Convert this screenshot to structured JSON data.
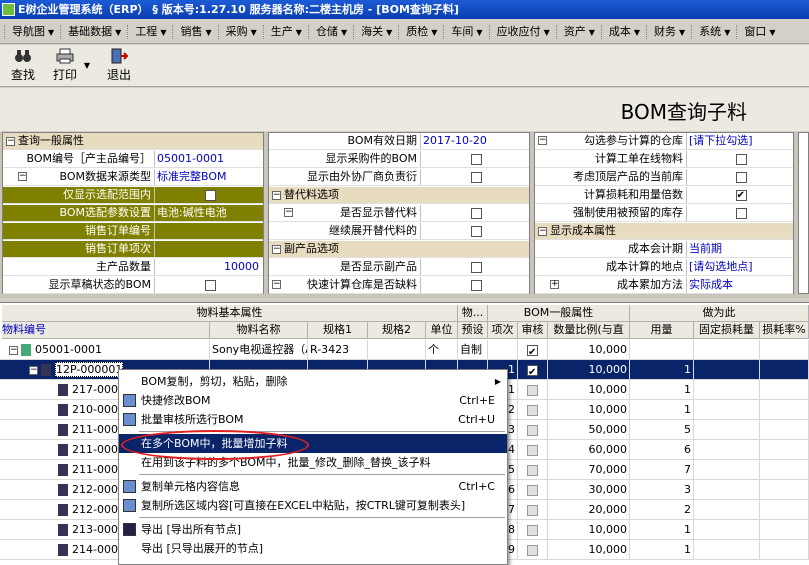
{
  "window": {
    "title": "E树企业管理系统（ERP） § 版本号:1.27.10  服务器名称:二楼主机房 - [BOM查询子料]"
  },
  "menu": [
    "导航图",
    "基础数据",
    "工程",
    "销售",
    "采购",
    "生产",
    "仓储",
    "海关",
    "质检",
    "车间",
    "应收应付",
    "资产",
    "成本",
    "财务",
    "系统",
    "窗口"
  ],
  "toolbar": {
    "find": "查找",
    "print": "打印",
    "exit": "退出"
  },
  "page_title": "BOM查询子料",
  "props": {
    "col1": [
      {
        "type": "section",
        "label": "查询一般属性"
      },
      {
        "label": "BOM编号［产主品编号］",
        "value": "05001-0001"
      },
      {
        "type": "sub",
        "label": "BOM数据来源类型",
        "value": "标准完整BOM"
      },
      {
        "type": "olive",
        "label": "仅显示选配范围内",
        "check": false
      },
      {
        "type": "olive",
        "label": "BOM选配参数设置",
        "value": "电池:碱性电池"
      },
      {
        "type": "olive",
        "label": "销售订单编号",
        "value": ""
      },
      {
        "type": "olive",
        "label": "销售订单项次",
        "value": ""
      },
      {
        "label": "主产品数量",
        "value": "10000"
      },
      {
        "label": "显示草稿状态的BOM",
        "check": false
      }
    ],
    "col2": [
      {
        "label": "BOM有效日期",
        "value": "2017-10-20"
      },
      {
        "label": "显示采购件的BOM",
        "check": false
      },
      {
        "label": "显示由外协厂商负责衍",
        "check": false
      },
      {
        "type": "section",
        "label": "替代料选项"
      },
      {
        "type": "sub",
        "label": "是否显示替代料",
        "check": false
      },
      {
        "label": "继续展开替代料的",
        "check": false
      },
      {
        "type": "section",
        "label": "副产品选项"
      },
      {
        "label": "是否显示副产品",
        "check": false
      },
      {
        "type": "sub0",
        "label": "快速计算仓库是否缺料",
        "check": false
      }
    ],
    "col3": [
      {
        "type": "sub0",
        "label": "勾选参与计算的仓库",
        "value": "[请下拉勾选]"
      },
      {
        "label": "计算工单在线物料",
        "check": false
      },
      {
        "label": "考虑顶层产品的当前库",
        "check": false
      },
      {
        "label": "计算损耗和用量倍数",
        "check": true
      },
      {
        "label": "强制使用被预留的库存",
        "check": false
      },
      {
        "type": "section2",
        "label": "显示成本属性"
      },
      {
        "label": "成本会计期",
        "value": "当前期"
      },
      {
        "label": "成本计算的地点",
        "value": "[请勾选地点]"
      },
      {
        "type": "plus",
        "label": "成本累加方法",
        "value": "实际成本"
      }
    ]
  },
  "grid": {
    "group_headers": [
      "物料基本属性",
      "物...",
      "BOM一般属性",
      "做为此"
    ],
    "columns": [
      "物料编号",
      "物料名称",
      "规格1",
      "规格2",
      "单位",
      "预设",
      "项次",
      "审核",
      "数量比例(与直",
      "用量",
      "固定损耗量",
      "损耗率%"
    ],
    "rows": [
      {
        "code": "05001-0001",
        "name": "Sony电视遥控器（A",
        "spec1": "R-3423",
        "spec2": "",
        "unit": "个",
        "preset": "自制",
        "item": "",
        "audit": true,
        "ratio": "10,000",
        "qty": "",
        "sel": false
      },
      {
        "code": "12P-000001",
        "name": "",
        "spec1": "",
        "spec2": "",
        "unit": "",
        "preset": "",
        "item": "1",
        "audit": true,
        "ratio": "10,000",
        "qty": "1",
        "sel": true
      },
      {
        "code": "217-000",
        "name": "",
        "spec1": "",
        "spec2": "",
        "unit": "",
        "preset": "",
        "item": "1",
        "audit": false,
        "ratio": "10,000",
        "qty": "1",
        "sel": false
      },
      {
        "code": "210-000",
        "name": "",
        "spec1": "",
        "spec2": "",
        "unit": "",
        "preset": "",
        "item": "2",
        "audit": false,
        "ratio": "10,000",
        "qty": "1",
        "sel": false
      },
      {
        "code": "211-000",
        "name": "",
        "spec1": "",
        "spec2": "",
        "unit": "",
        "preset": "",
        "item": "3",
        "audit": false,
        "ratio": "50,000",
        "qty": "5",
        "sel": false
      },
      {
        "code": "211-000",
        "name": "",
        "spec1": "",
        "spec2": "",
        "unit": "",
        "preset": "",
        "item": "4",
        "audit": false,
        "ratio": "60,000",
        "qty": "6",
        "sel": false
      },
      {
        "code": "211-000",
        "name": "",
        "spec1": "",
        "spec2": "",
        "unit": "",
        "preset": "",
        "item": "5",
        "audit": false,
        "ratio": "70,000",
        "qty": "7",
        "sel": false
      },
      {
        "code": "212-000",
        "name": "",
        "spec1": "",
        "spec2": "",
        "unit": "",
        "preset": "",
        "item": "6",
        "audit": false,
        "ratio": "30,000",
        "qty": "3",
        "sel": false
      },
      {
        "code": "212-000",
        "name": "",
        "spec1": "",
        "spec2": "",
        "unit": "",
        "preset": "",
        "item": "7",
        "audit": false,
        "ratio": "20,000",
        "qty": "2",
        "sel": false
      },
      {
        "code": "213-000",
        "name": "",
        "spec1": "",
        "spec2": "",
        "unit": "",
        "preset": "",
        "item": "8",
        "audit": false,
        "ratio": "10,000",
        "qty": "1",
        "sel": false
      },
      {
        "code": "214-000",
        "name": "",
        "spec1": "",
        "spec2": "",
        "unit": "",
        "preset": "",
        "item": "9",
        "audit": false,
        "ratio": "10,000",
        "qty": "1",
        "sel": false
      }
    ]
  },
  "context_menu": [
    {
      "label": "BOM复制，剪切，粘贴，删除",
      "shortcut": "",
      "arrow": true,
      "icon": ""
    },
    {
      "label": "快捷修改BOM",
      "shortcut": "Ctrl+E",
      "icon": "edit-icon"
    },
    {
      "label": "批量审核所选行BOM",
      "shortcut": "Ctrl+U",
      "icon": "audit-icon"
    },
    {
      "type": "sep"
    },
    {
      "label": "在多个BOM中，批量增加子料",
      "shortcut": "",
      "selected": true
    },
    {
      "label": "在用到该子料的多个BOM中，批量_修改_删除_替换_该子料",
      "shortcut": ""
    },
    {
      "type": "sep"
    },
    {
      "label": "复制单元格内容信息",
      "shortcut": "Ctrl+C",
      "icon": "copy-icon"
    },
    {
      "label": "复制所选区域内容[可直接在EXCEL中粘贴，按CTRL键可复制表头]",
      "shortcut": "",
      "icon": "copy-icon"
    },
    {
      "type": "sep"
    },
    {
      "label": "导出 [导出所有节点]",
      "shortcut": "",
      "icon": "save-icon"
    },
    {
      "label": "导出 [只导出展开的节点]",
      "shortcut": ""
    }
  ]
}
